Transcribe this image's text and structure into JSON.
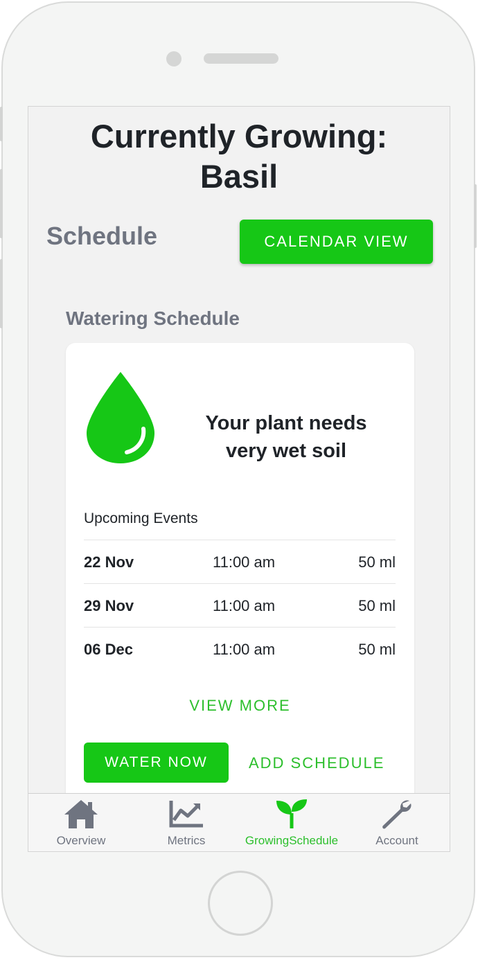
{
  "colors": {
    "accent": "#16c716",
    "accent_text": "#2cbf2c",
    "heading_gray": "#6f7480",
    "text_dark": "#1f2328"
  },
  "header": {
    "title_line1": "Currently Growing:",
    "title_line2": "Basil"
  },
  "schedule": {
    "heading": "Schedule",
    "calendar_button": "CALENDAR VIEW"
  },
  "watering": {
    "heading": "Watering Schedule",
    "icon": "water-drop-icon",
    "message_line1": "Your plant needs",
    "message_line2": "very wet soil",
    "upcoming_label": "Upcoming Events",
    "events": [
      {
        "date": "22 Nov",
        "time": "11:00 am",
        "amount": "50 ml"
      },
      {
        "date": "29 Nov",
        "time": "11:00 am",
        "amount": "50 ml"
      },
      {
        "date": "06 Dec",
        "time": "11:00 am",
        "amount": "50 ml"
      }
    ],
    "view_more": "VIEW MORE",
    "water_now": "WATER NOW",
    "add_schedule": "ADD SCHEDULE"
  },
  "tabs": [
    {
      "label": "Overview",
      "icon": "home-icon",
      "active": false
    },
    {
      "label": "Metrics",
      "icon": "chart-icon",
      "active": false
    },
    {
      "label": "GrowingSchedule",
      "icon": "sprout-icon",
      "active": true
    },
    {
      "label": "Account",
      "icon": "wrench-icon",
      "active": false
    }
  ]
}
